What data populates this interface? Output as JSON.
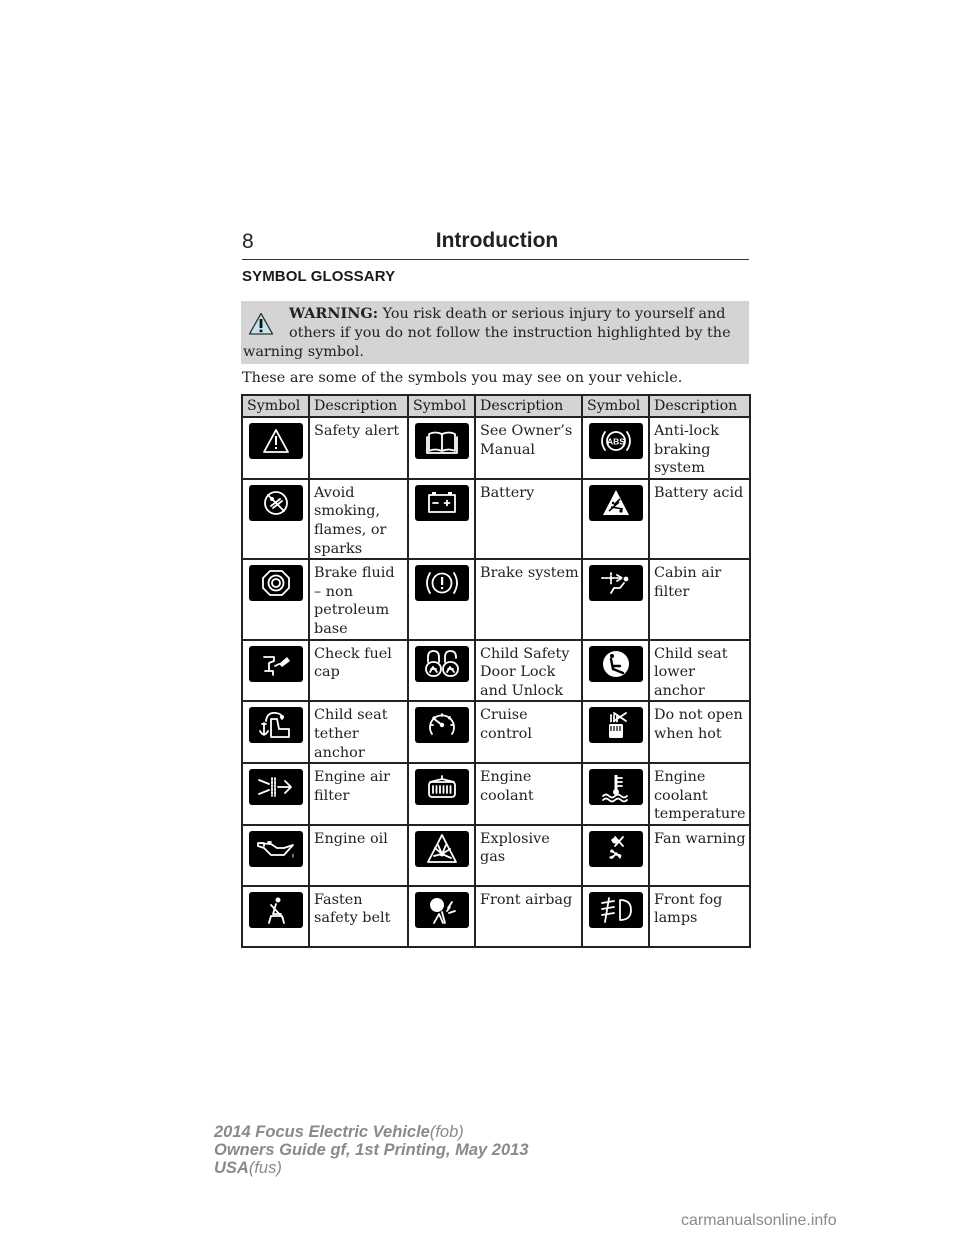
{
  "header": {
    "page_number": "8",
    "chapter_title": "Introduction"
  },
  "section_title": "SYMBOL GLOSSARY",
  "warning": {
    "icon": "warning-triangle-icon",
    "label": "WARNING:",
    "line1": "You risk death or serious injury to yourself and",
    "line2": "others if you do not follow the instruction highlighted by the",
    "line3": "warning symbol."
  },
  "intro_text": "These are some of the symbols you may see on your vehicle.",
  "table": {
    "headers": [
      "Symbol",
      "Description",
      "Symbol",
      "Description",
      "Symbol",
      "Description"
    ],
    "rows": [
      [
        {
          "icon": "safety-alert-icon",
          "description": "Safety alert"
        },
        {
          "icon": "owners-manual-icon",
          "description": "See Owner’s Manual"
        },
        {
          "icon": "abs-icon",
          "description": "Anti-lock braking system"
        }
      ],
      [
        {
          "icon": "no-smoking-icon",
          "description": "Avoid smoking, flames, or sparks"
        },
        {
          "icon": "battery-icon",
          "description": "Battery"
        },
        {
          "icon": "battery-acid-icon",
          "description": "Battery acid"
        }
      ],
      [
        {
          "icon": "brake-fluid-icon",
          "description": "Brake fluid – non petroleum base"
        },
        {
          "icon": "brake-system-icon",
          "description": "Brake system"
        },
        {
          "icon": "cabin-air-filter-icon",
          "description": "Cabin air filter"
        }
      ],
      [
        {
          "icon": "fuel-cap-icon",
          "description": "Check fuel cap"
        },
        {
          "icon": "child-lock-icon",
          "description": "Child Safety Door Lock and Unlock"
        },
        {
          "icon": "child-seat-lower-anchor-icon",
          "description": "Child seat lower anchor"
        }
      ],
      [
        {
          "icon": "child-seat-tether-icon",
          "description": "Child seat tether anchor"
        },
        {
          "icon": "cruise-control-icon",
          "description": "Cruise control"
        },
        {
          "icon": "do-not-open-hot-icon",
          "description": "Do not open when hot"
        }
      ],
      [
        {
          "icon": "engine-air-filter-icon",
          "description": "Engine air filter"
        },
        {
          "icon": "engine-coolant-icon",
          "description": "Engine coolant"
        },
        {
          "icon": "coolant-temperature-icon",
          "description": "Engine coolant temperature"
        }
      ],
      [
        {
          "icon": "engine-oil-icon",
          "description": "Engine oil"
        },
        {
          "icon": "explosive-gas-icon",
          "description": "Explosive gas"
        },
        {
          "icon": "fan-warning-icon",
          "description": "Fan warning"
        }
      ],
      [
        {
          "icon": "seat-belt-icon",
          "description": "Fasten safety belt"
        },
        {
          "icon": "front-airbag-icon",
          "description": "Front airbag"
        },
        {
          "icon": "front-fog-lamps-icon",
          "description": "Front fog lamps"
        }
      ]
    ]
  },
  "footer": {
    "line1_bold": "2014 Focus Electric Vehicle",
    "line1_light": "(fob)",
    "line2": "Owners Guide gf, 1st Printing, May 2013",
    "line3_bold": "USA",
    "line3_light": "(fus)"
  },
  "watermark": "carmanualsonline.info"
}
